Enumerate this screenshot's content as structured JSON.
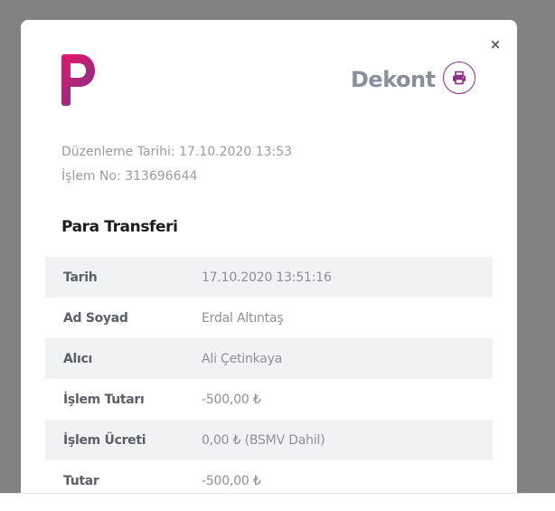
{
  "modal": {
    "close_label": "×",
    "title": "Dekont",
    "print_icon": "printer-icon",
    "logo_letter": "p",
    "brand_colors": [
      "#e2186b",
      "#8a2f86"
    ],
    "meta": {
      "date_line": "Düzenleme Tarihi: 17.10.2020 13:53",
      "transaction_line": "İşlem No: 313696644"
    },
    "section_title": "Para Transferi",
    "rows": [
      {
        "label": "Tarih",
        "value": "17.10.2020 13:51:16"
      },
      {
        "label": "Ad Soyad",
        "value": "Erdal Altıntaş"
      },
      {
        "label": "Alıcı",
        "value": "Ali Çetinkaya"
      },
      {
        "label": "İşlem Tutarı",
        "value": "-500,00 ₺"
      },
      {
        "label": "İşlem Ücreti",
        "value": "0,00 ₺ (BSMV Dahil)"
      },
      {
        "label": "Tutar",
        "value": "-500,00 ₺"
      }
    ]
  }
}
